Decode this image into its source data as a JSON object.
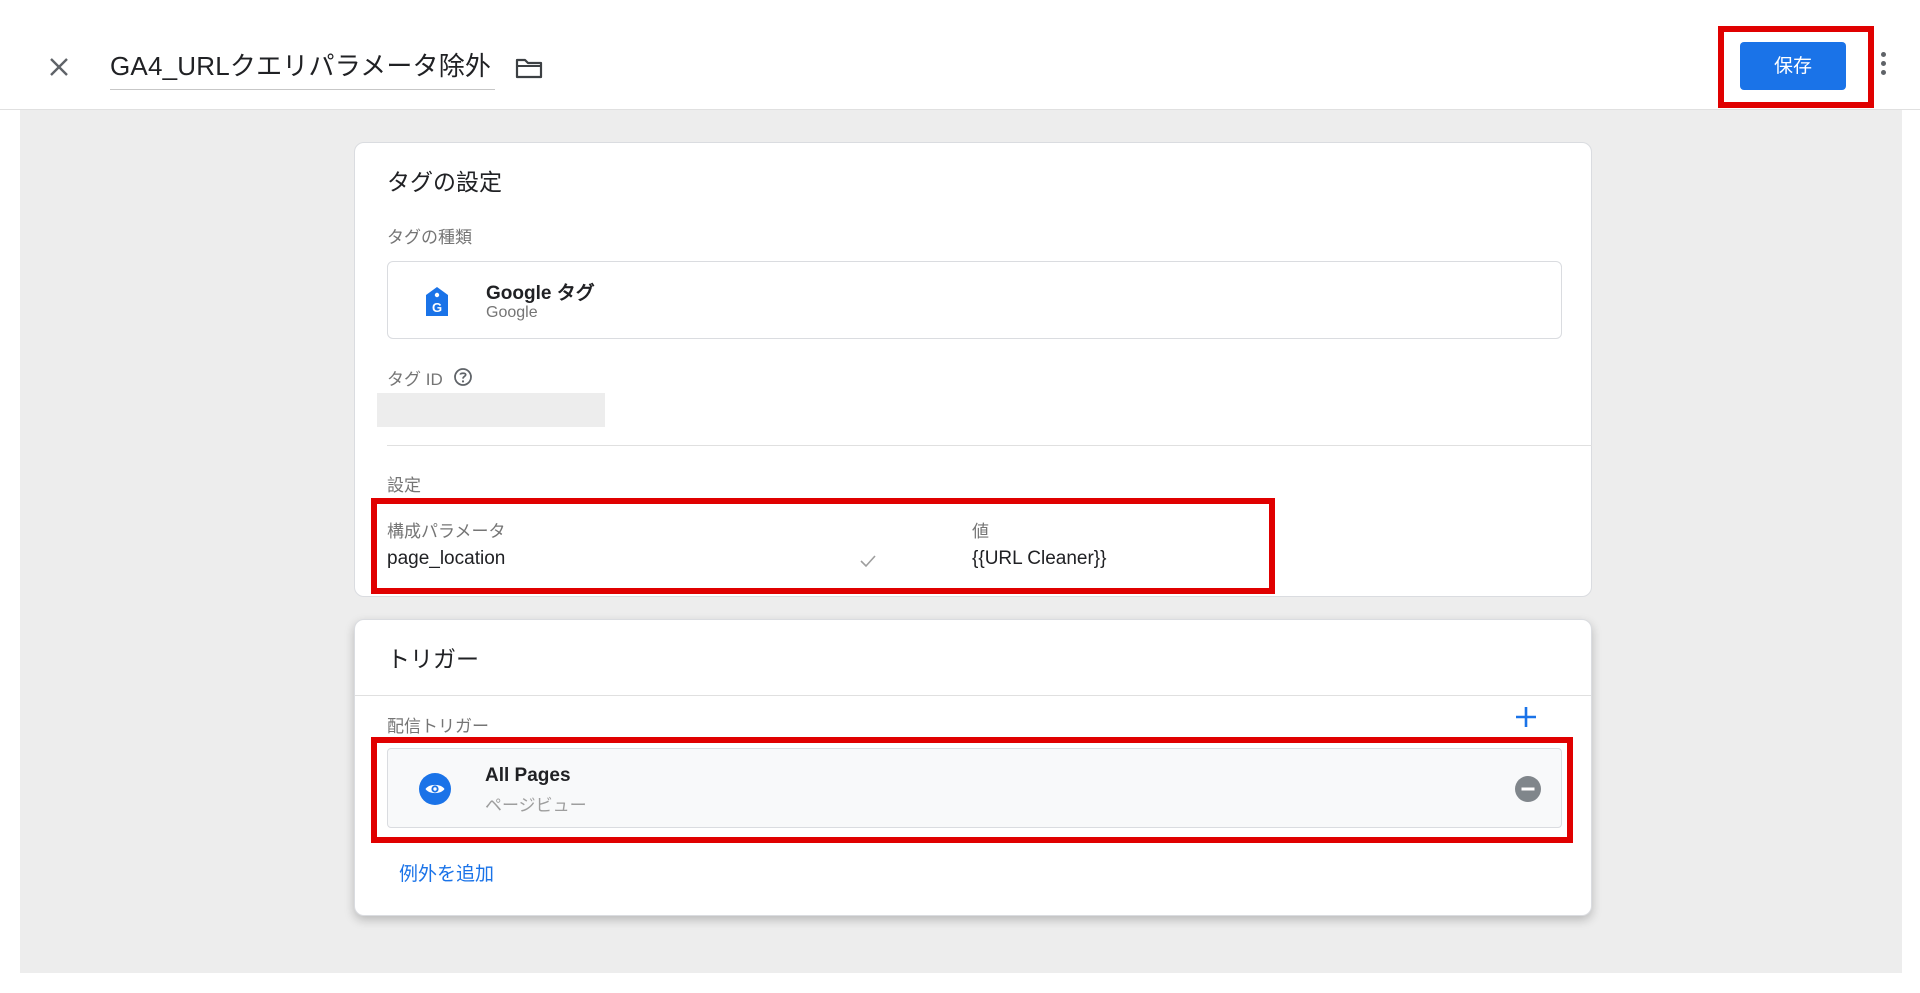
{
  "header": {
    "title": "GA4_URLクエリパラメータ除外",
    "save_label": "保存"
  },
  "tag_config": {
    "section_title": "タグの設定",
    "tag_type_label": "タグの種類",
    "tag_type_name": "Google タグ",
    "tag_type_vendor": "Google",
    "tag_id_label": "タグ ID",
    "tag_id_value": "",
    "settings_label": "設定",
    "param_header_name": "構成パラメータ",
    "param_header_value": "値",
    "params": [
      {
        "name": "page_location",
        "value": "{{URL Cleaner}}"
      }
    ]
  },
  "triggers": {
    "section_title": "トリガー",
    "firing_label": "配信トリガー",
    "items": [
      {
        "name": "All Pages",
        "type": "ページビュー"
      }
    ],
    "add_exception_label": "例外を追加"
  },
  "colors": {
    "accent": "#1a73e8",
    "highlight": "#e00000",
    "background": "#ededed"
  },
  "icons": [
    "close-icon",
    "folder-icon",
    "more-vert-icon",
    "google-tag-icon",
    "help-icon",
    "check-icon",
    "add-icon",
    "eye-icon",
    "remove-circle-icon"
  ]
}
